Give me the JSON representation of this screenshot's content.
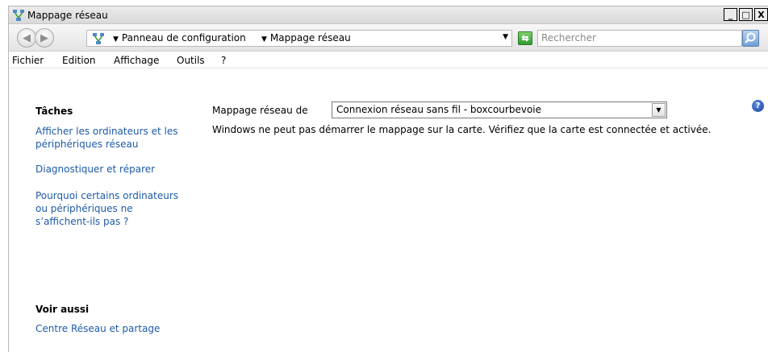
{
  "window": {
    "title": "Mappage réseau"
  },
  "title_buttons": {
    "minimize": "_",
    "maximize": "□",
    "close": "X"
  },
  "address": {
    "crumbs": [
      "Panneau de configuration",
      "Mappage réseau"
    ],
    "search_placeholder": "Rechercher"
  },
  "menu": [
    "Fichier",
    "Edition",
    "Affichage",
    "Outils",
    "?"
  ],
  "sidebar": {
    "tasks_heading": "Tâches",
    "tasks": [
      "Afficher les ordinateurs et les périphériques réseau",
      "Diagnostiquer et réparer",
      "Pourquoi certains ordinateurs ou périphériques ne s’affichent-ils pas ?"
    ],
    "see_also_heading": "Voir aussi",
    "see_also": [
      "Centre Réseau et partage"
    ]
  },
  "main": {
    "map_label": "Mappage réseau de",
    "selected_connection": "Connexion réseau sans fil - boxcourbevoie",
    "message": "Windows ne peut pas démarrer le mappage sur la carte. Vérifiez que la carte est connectée et activée."
  },
  "colors": {
    "link": "#1e5aa8",
    "accent": "#1a3f9a"
  },
  "icons": [
    "network-map-icon",
    "back-icon",
    "forward-icon",
    "refresh-icon",
    "search-icon",
    "help-icon",
    "dropdown-arrow-icon"
  ]
}
